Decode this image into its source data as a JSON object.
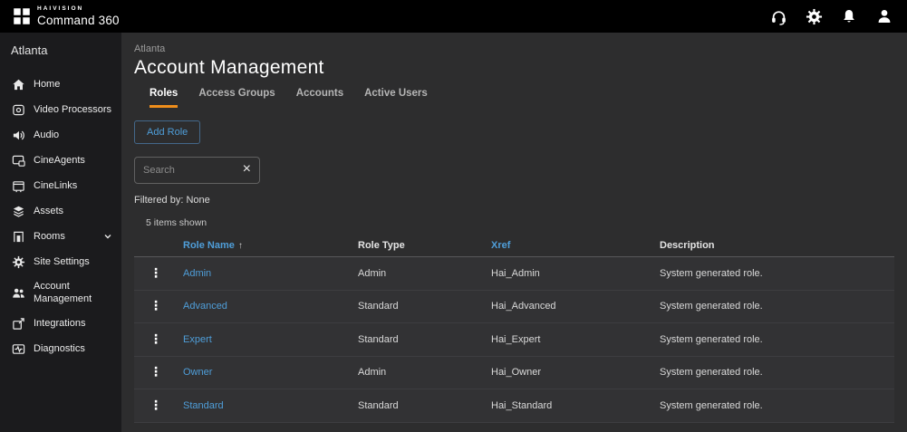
{
  "topbar": {
    "brand_top": "HAIVISION",
    "brand_bottom": "Command 360"
  },
  "sidebar": {
    "site_name": "Atlanta",
    "items": [
      {
        "label": "Home"
      },
      {
        "label": "Video Processors"
      },
      {
        "label": "Audio"
      },
      {
        "label": "CineAgents"
      },
      {
        "label": "CineLinks"
      },
      {
        "label": "Assets"
      },
      {
        "label": "Rooms",
        "expandable": true
      },
      {
        "label": "Site Settings"
      },
      {
        "label": "Account Management",
        "active": true
      },
      {
        "label": "Integrations"
      },
      {
        "label": "Diagnostics"
      }
    ]
  },
  "main": {
    "breadcrumb": "Atlanta",
    "title": "Account Management",
    "tabs": [
      {
        "label": "Roles",
        "active": true
      },
      {
        "label": "Access Groups",
        "active": false
      },
      {
        "label": "Accounts",
        "active": false
      },
      {
        "label": "Active Users",
        "active": false
      }
    ],
    "add_role_button": "Add Role",
    "search": {
      "placeholder": "Search",
      "value": ""
    },
    "filter_status": "Filtered by: None",
    "items_shown": "5 items shown",
    "table": {
      "headers": {
        "role_name": "Role Name",
        "role_type": "Role Type",
        "xref": "Xref",
        "description": "Description"
      },
      "sort": {
        "column": "Role Name",
        "direction": "ascending"
      },
      "rows": [
        {
          "role_name": "Admin",
          "role_type": "Admin",
          "xref": "Hai_Admin",
          "description": "System generated role."
        },
        {
          "role_name": "Advanced",
          "role_type": "Standard",
          "xref": "Hai_Advanced",
          "description": "System generated role."
        },
        {
          "role_name": "Expert",
          "role_type": "Standard",
          "xref": "Hai_Expert",
          "description": "System generated role."
        },
        {
          "role_name": "Owner",
          "role_type": "Admin",
          "xref": "Hai_Owner",
          "description": "System generated role."
        },
        {
          "role_name": "Standard",
          "role_type": "Standard",
          "xref": "Hai_Standard",
          "description": "System generated role."
        }
      ]
    }
  },
  "glyphs": {
    "clear_search": "×",
    "sort_asc": "↑",
    "kebab": "⋮"
  },
  "colors": {
    "accent_orange": "#ef8e1b",
    "link_blue": "#4f9ed9",
    "topbar_bg": "#000000",
    "sidebar_bg": "#1b1b1d",
    "content_bg": "#2d2d2e"
  }
}
